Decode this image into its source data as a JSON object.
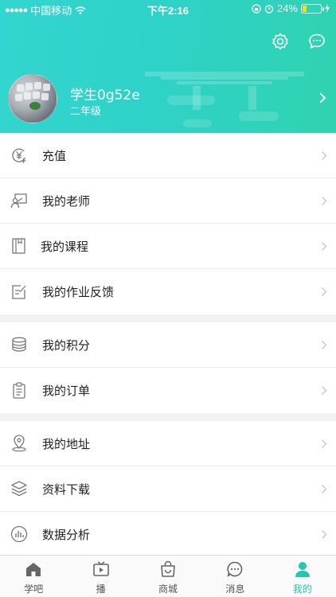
{
  "status_bar": {
    "carrier": "中国移动",
    "time": "下午2:16",
    "battery": "24%",
    "battery_level": 0.24
  },
  "header": {
    "username": "学生0g52e",
    "grade": "二年级",
    "icons": [
      "settings-icon",
      "message-icon"
    ]
  },
  "menu_groups": [
    [
      {
        "label": "充值",
        "icon": "recharge-icon"
      },
      {
        "label": "我的老师",
        "icon": "teacher-icon"
      },
      {
        "label": "我的课程",
        "icon": "course-icon"
      },
      {
        "label": "我的作业反馈",
        "icon": "homework-icon"
      }
    ],
    [
      {
        "label": "我的积分",
        "icon": "points-icon"
      },
      {
        "label": "我的订单",
        "icon": "order-icon"
      }
    ],
    [
      {
        "label": "我的地址",
        "icon": "location-icon"
      },
      {
        "label": "资料下载",
        "icon": "download-icon"
      },
      {
        "label": "数据分析",
        "icon": "analytics-icon"
      }
    ]
  ],
  "tabbar": {
    "items": [
      {
        "label": "学吧",
        "icon": "home-icon"
      },
      {
        "label": "播",
        "icon": "play-icon"
      },
      {
        "label": "商城",
        "icon": "shop-icon"
      },
      {
        "label": "消息",
        "icon": "chat-icon"
      },
      {
        "label": "我的",
        "icon": "profile-icon"
      }
    ],
    "active": "我的",
    "active_color": "#25c6b0",
    "inactive_color": "#555555"
  },
  "colors": {
    "header_gradient_start": "#32d6d0",
    "header_gradient_end": "#2fd3b0"
  }
}
